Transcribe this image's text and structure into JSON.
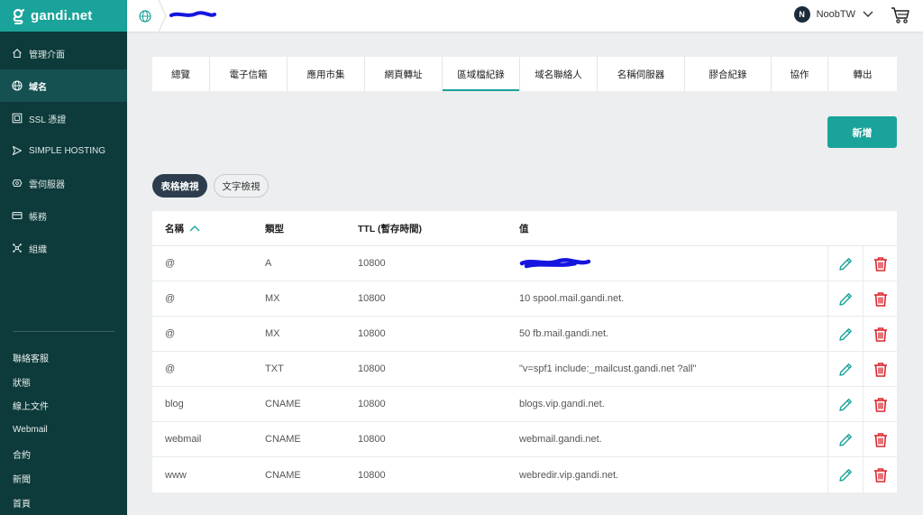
{
  "brand": {
    "name": "gandi.net"
  },
  "sidebar": {
    "items": [
      {
        "label": "管理介面",
        "icon": "home-icon",
        "active": false
      },
      {
        "label": "域名",
        "icon": "globe-icon",
        "active": true
      },
      {
        "label": "SSL 憑證",
        "icon": "certificate-icon",
        "active": false
      },
      {
        "label": "SIMPLE HOSTING",
        "icon": "paper-plane-icon",
        "active": false
      },
      {
        "label": "雲伺服器",
        "icon": "cloud-server-icon",
        "active": false
      },
      {
        "label": "帳務",
        "icon": "credit-card-icon",
        "active": false
      },
      {
        "label": "組織",
        "icon": "organization-icon",
        "active": false
      }
    ],
    "footer": [
      "聯絡客服",
      "狀態",
      "線上文件",
      "Webmail",
      "合約",
      "新聞",
      "首頁"
    ]
  },
  "topbar": {
    "user_initial": "N",
    "user_name": "NoobTW"
  },
  "tabs": [
    {
      "label": "總覽",
      "active": false
    },
    {
      "label": "電子信箱",
      "active": false
    },
    {
      "label": "應用市集",
      "active": false
    },
    {
      "label": "網頁轉址",
      "active": false
    },
    {
      "label": "區域檔紀錄",
      "active": true
    },
    {
      "label": "域名聯絡人",
      "active": false
    },
    {
      "label": "名稱伺服器",
      "active": false
    },
    {
      "label": "膠合紀錄",
      "active": false
    },
    {
      "label": "協作",
      "active": false
    },
    {
      "label": "轉出",
      "active": false
    }
  ],
  "actions": {
    "add_label": "新增"
  },
  "view": {
    "table_label": "表格檢視",
    "text_label": "文字檢視"
  },
  "table": {
    "headers": {
      "name": "名稱",
      "type": "類型",
      "ttl": "TTL (暫存時間)",
      "value": "值"
    },
    "rows": [
      {
        "name": "@",
        "type": "A",
        "ttl": "10800",
        "value": ""
      },
      {
        "name": "@",
        "type": "MX",
        "ttl": "10800",
        "value": "10 spool.mail.gandi.net."
      },
      {
        "name": "@",
        "type": "MX",
        "ttl": "10800",
        "value": "50 fb.mail.gandi.net."
      },
      {
        "name": "@",
        "type": "TXT",
        "ttl": "10800",
        "value": "\"v=spf1 include:_mailcust.gandi.net ?all\""
      },
      {
        "name": "blog",
        "type": "CNAME",
        "ttl": "10800",
        "value": "blogs.vip.gandi.net."
      },
      {
        "name": "webmail",
        "type": "CNAME",
        "ttl": "10800",
        "value": "webmail.gandi.net."
      },
      {
        "name": "www",
        "type": "CNAME",
        "ttl": "10800",
        "value": "webredir.vip.gandi.net."
      }
    ]
  },
  "colors": {
    "accent": "#1aa39a",
    "sidebar": "#0d3a3a",
    "delete": "#d9282f",
    "redaction": "#1515e0"
  }
}
